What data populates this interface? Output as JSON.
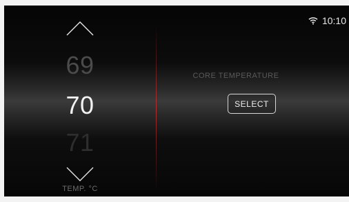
{
  "status_bar": {
    "wifi_icon": "wifi-icon",
    "time": "10:10"
  },
  "temperature_picker": {
    "up_icon": "chevron-up-icon",
    "down_icon": "chevron-down-icon",
    "previous_value": "69",
    "current_value": "70",
    "next_value": "71",
    "unit_label": "TEMP. °C"
  },
  "detail_panel": {
    "title": "CORE TEMPERATURE",
    "select_label": "SELECT"
  },
  "colors": {
    "divider_accent": "#c82d2d",
    "text_primary": "#f2f2f2"
  }
}
